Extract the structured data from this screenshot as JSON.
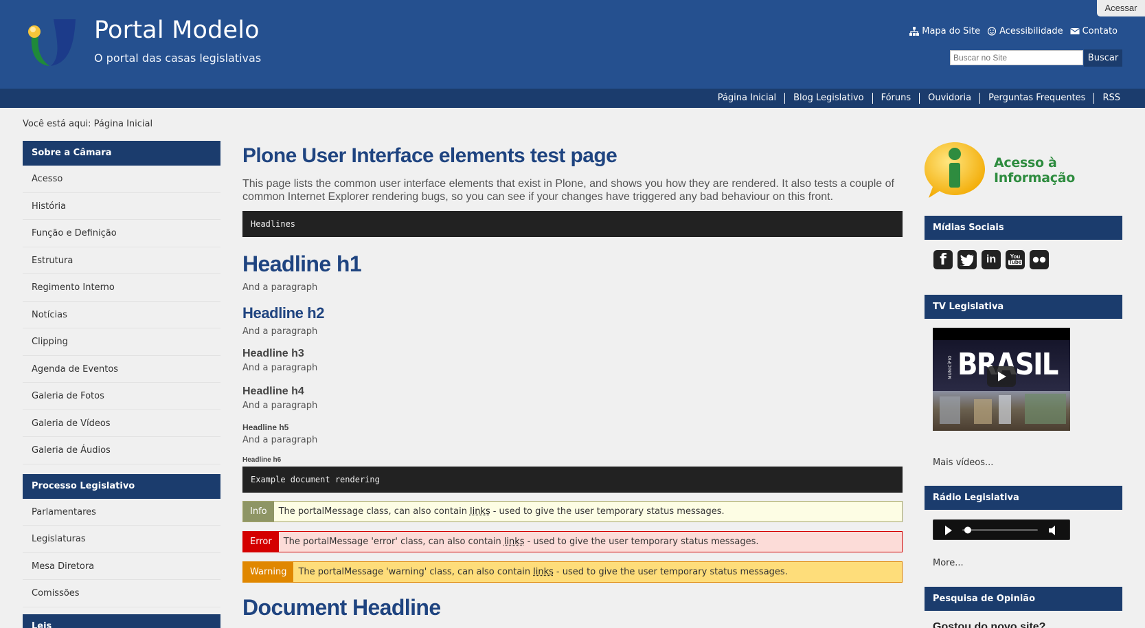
{
  "header": {
    "title": "Portal Modelo",
    "subtitle": "O portal das casas legislativas",
    "login_label": "Acessar",
    "top_links": [
      {
        "label": "Mapa do Site",
        "icon": "sitemap-icon"
      },
      {
        "label": "Acessibilidade",
        "icon": "accessibility-icon"
      },
      {
        "label": "Contato",
        "icon": "envelope-icon"
      }
    ],
    "search": {
      "placeholder": "Buscar no Site",
      "button_label": "Buscar"
    }
  },
  "nav": {
    "items": [
      "Página Inicial",
      "Blog Legislativo",
      "Fóruns",
      "Ouvidoria",
      "Perguntas Frequentes",
      "RSS"
    ]
  },
  "breadcrumb": {
    "prefix": "Você está aqui:",
    "current": "Página Inicial"
  },
  "left": {
    "sections": [
      {
        "title": "Sobre a Câmara",
        "items": [
          "Acesso",
          "História",
          "Função e Definição",
          "Estrutura",
          "Regimento Interno",
          "Notícias",
          "Clipping",
          "Agenda de Eventos",
          "Galeria de Fotos",
          "Galeria de Vídeos",
          "Galeria de Áudios"
        ]
      },
      {
        "title": "Processo Legislativo",
        "items": [
          "Parlamentares",
          "Legislaturas",
          "Mesa Diretora",
          "Comissões"
        ]
      },
      {
        "title": "Leis",
        "items": []
      }
    ]
  },
  "main": {
    "title": "Plone User Interface elements test page",
    "description": "This page lists the common user interface elements that exist in Plone, and shows you how they are rendered. It also tests a couple of common Internet Explorer rendering bugs, so you can see if your changes have triggered any bad behaviour on this front.",
    "code_headlines": "Headlines",
    "h1": "Headline h1",
    "h2": "Headline h2",
    "h3": "Headline h3",
    "h4": "Headline h4",
    "h5": "Headline h5",
    "h6": "Headline h6",
    "paragraph": "And a paragraph",
    "code_example": "Example document rendering",
    "messages": {
      "info": {
        "tag": "Info",
        "before": "The portalMessage class, can also contain",
        "link": "links",
        "after": "- used to give the user temporary status messages."
      },
      "error": {
        "tag": "Error",
        "before": "The portalMessage 'error' class, can also contain",
        "link": "links",
        "after": "- used to give the user temporary status messages."
      },
      "warning": {
        "tag": "Warning",
        "before": "The portalMessage 'warning' class, can also contain",
        "link": "links",
        "after": "- used to give the user temporary status messages."
      }
    },
    "doc_headline": "Document Headline"
  },
  "right": {
    "access_info": {
      "line1": "Acesso à",
      "line2": "Informação"
    },
    "social_title": "Mídias Sociais",
    "social_icons": [
      "facebook-icon",
      "twitter-icon",
      "linkedin-icon",
      "youtube-icon",
      "flickr-icon"
    ],
    "tv_title": "TV Legislativa",
    "video_label_small": "MUNICÍPIO",
    "video_label_big": "BRASIL",
    "more_videos": "Mais vídeos...",
    "radio_title": "Rádio Legislativa",
    "more": "More...",
    "poll_title": "Pesquisa de Opinião",
    "poll_question": "Gostou do novo site?"
  },
  "colors": {
    "header": "#25508f",
    "nav": "#1b3c6d",
    "title": "#1f4480"
  }
}
